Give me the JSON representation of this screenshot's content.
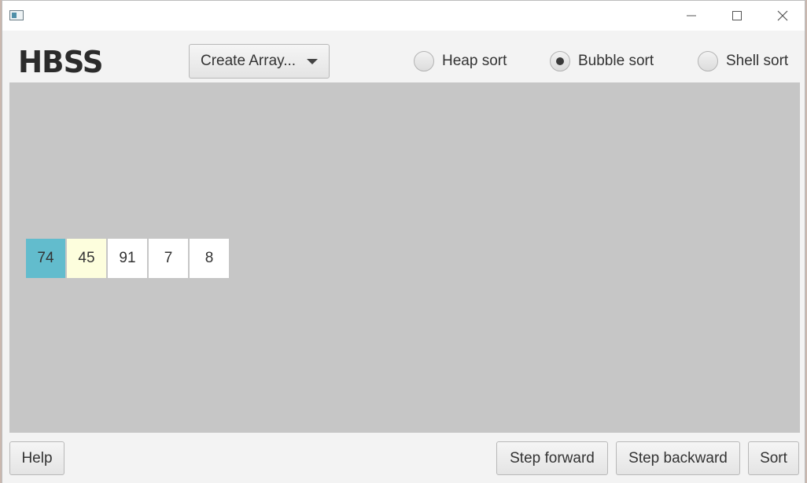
{
  "app": {
    "logo": "HBSS",
    "icon": "app-window-icon"
  },
  "window_controls": [
    "minimize-icon",
    "maximize-icon",
    "close-icon"
  ],
  "toolbar": {
    "create_array_label": "Create Array...",
    "algorithms": [
      {
        "label": "Heap sort",
        "selected": false
      },
      {
        "label": "Bubble sort",
        "selected": true
      },
      {
        "label": "Shell sort",
        "selected": false
      }
    ]
  },
  "array": {
    "values": [
      "74",
      "45",
      "91",
      "7",
      "8"
    ],
    "highlight_colors": [
      "#62bccd",
      "#fdfedd",
      "#ffffff",
      "#ffffff",
      "#ffffff"
    ]
  },
  "footer": {
    "help_label": "Help",
    "step_forward_label": "Step forward",
    "step_backward_label": "Step backward",
    "sort_label": "Sort"
  },
  "colors": {
    "canvas": "#c6c6c6",
    "window": "#f3f3f3"
  }
}
